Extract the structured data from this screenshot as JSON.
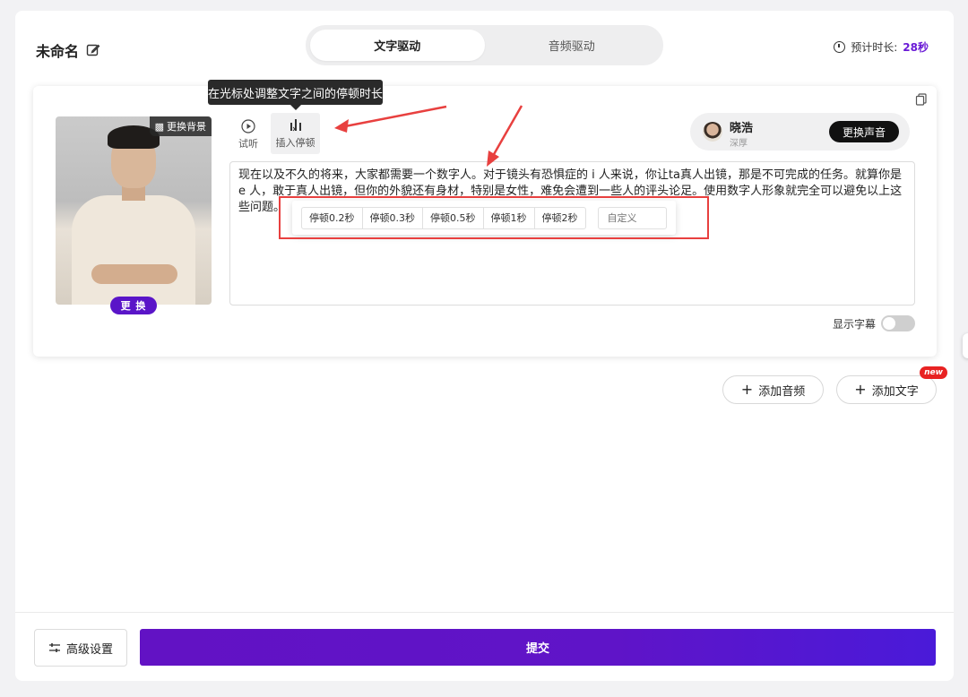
{
  "header": {
    "title": "未命名",
    "mode_tabs": [
      {
        "label": "文字驱动",
        "active": true
      },
      {
        "label": "音频驱动",
        "active": false
      }
    ],
    "eta_label": "预计时长:",
    "eta_value": "28秒"
  },
  "editor": {
    "avatar": {
      "bg_badge": "更换背景",
      "replace_label": "更 换"
    },
    "tools": {
      "listen_label": "试听",
      "pause_label": "插入停顿"
    },
    "tooltip": "在光标处调整文字之间的停顿时长",
    "voice": {
      "name": "晓浩",
      "tag": "深厚",
      "change_label": "更换声音"
    },
    "text_content": "现在以及不久的将来，大家都需要一个数字人。对于镜头有恐惧症的 i 人来说，你让ta真人出镜，那是不可完成的任务。就算你是 e 人，敢于真人出镜，但你的外貌还有身材，特别是女性，难免会遭到一些人的评头论足。使用数字人形象就完全可以避免以上这些问题。",
    "pause_options": [
      "停顿0.2秒",
      "停顿0.3秒",
      "停顿0.5秒",
      "停顿1秒",
      "停顿2秒"
    ],
    "custom_placeholder": "自定义",
    "subtitle_label": "显示字幕",
    "subtitle_on": false
  },
  "actions": {
    "add_audio": "添加音频",
    "add_text": "添加文字",
    "new_badge": "new"
  },
  "footer": {
    "advanced_label": "高级设置",
    "submit_label": "提交"
  },
  "colors": {
    "accent": "#5a15c8",
    "annotation": "#e8403f",
    "badge": "#e82222"
  }
}
